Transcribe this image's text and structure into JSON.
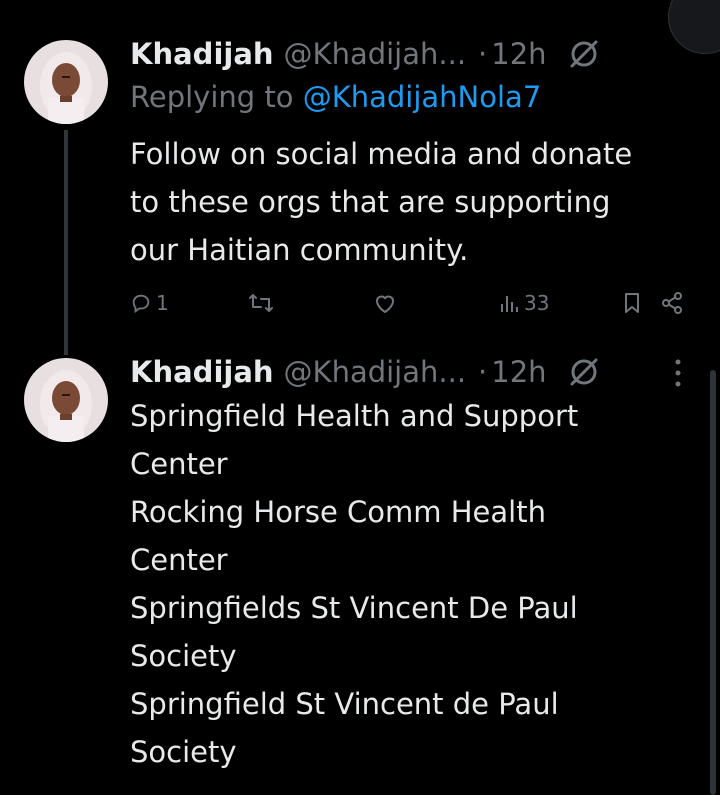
{
  "tweets": [
    {
      "name": "Khadijah",
      "handle": "@Khadijah...",
      "dot": "·",
      "time": "12h",
      "replying_prefix": "Replying to",
      "replying_mention": "@KhadijahNola7",
      "lines": [
        "Follow on social media and donate",
        "to these orgs that are supporting",
        "our Haitian community."
      ],
      "reply_count": "1",
      "views_count": "33"
    },
    {
      "name": "Khadijah",
      "handle": "@Khadijah...",
      "dot": "·",
      "time": "12h",
      "lines": [
        "Springfield Health and Support",
        "Center",
        "Rocking Horse Comm Health",
        "Center",
        "Springfields St Vincent De Paul",
        "Society",
        "Springfield St Vincent de Paul",
        "Society"
      ]
    }
  ],
  "icons": {
    "reply": "reply-icon",
    "retweet": "retweet-icon",
    "like": "heart-icon",
    "views": "views-icon",
    "bookmark": "bookmark-icon",
    "share": "share-icon",
    "grok": "grok-icon",
    "more": "more-icon"
  },
  "colors": {
    "background": "#000000",
    "text": "#e7e9ea",
    "muted": "#71767b",
    "link": "#1d9bf0"
  }
}
